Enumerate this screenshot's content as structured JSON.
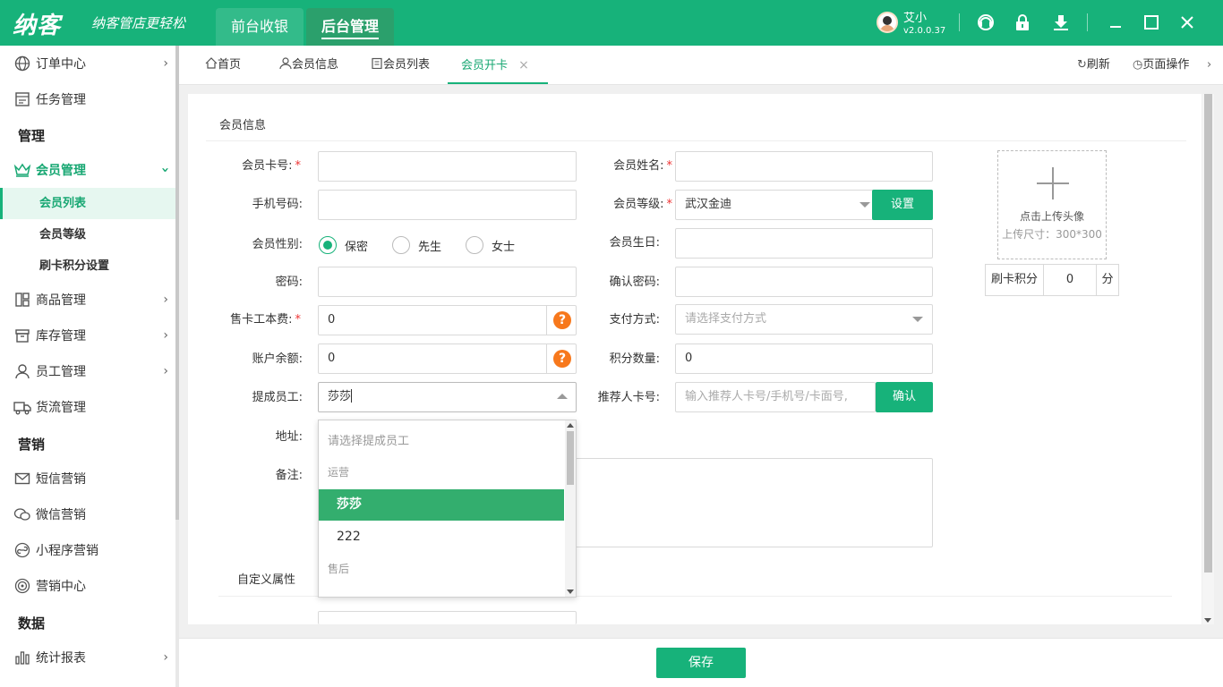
{
  "brand": {
    "logo": "纳客",
    "slogan": "纳客管店更轻松"
  },
  "topnav": [
    {
      "label": "前台收银"
    },
    {
      "label": "后台管理"
    }
  ],
  "user": {
    "name": "艾小",
    "version": "v2.0.0.37"
  },
  "sidebar": {
    "items": [
      {
        "label": "订单中心",
        "icon": "globe-icon"
      },
      {
        "label": "任务管理",
        "icon": "task-icon"
      },
      {
        "label": "会员管理",
        "icon": "crown-icon"
      },
      {
        "label": "商品管理",
        "icon": "goods-icon"
      },
      {
        "label": "库存管理",
        "icon": "box-icon"
      },
      {
        "label": "员工管理",
        "icon": "user-icon"
      },
      {
        "label": "货流管理",
        "icon": "truck-icon"
      },
      {
        "label": "短信营销",
        "icon": "mail-icon"
      },
      {
        "label": "微信营销",
        "icon": "wechat-icon"
      },
      {
        "label": "小程序营销",
        "icon": "miniapp-icon"
      },
      {
        "label": "营销中心",
        "icon": "target-icon"
      },
      {
        "label": "统计报表",
        "icon": "chart-icon"
      }
    ],
    "headers": [
      "管理",
      "营销",
      "数据"
    ],
    "subitems": [
      "会员列表",
      "会员等级",
      "刷卡积分设置"
    ]
  },
  "tabs": [
    {
      "label": "首页"
    },
    {
      "label": "会员信息"
    },
    {
      "label": "会员列表"
    },
    {
      "label": "会员开卡"
    }
  ],
  "tab_actions": {
    "refresh": "刷新",
    "page_ops": "页面操作"
  },
  "form": {
    "section_title": "会员信息",
    "card_no": {
      "label": "会员卡号:",
      "value": ""
    },
    "name": {
      "label": "会员姓名:",
      "value": ""
    },
    "phone": {
      "label": "手机号码:",
      "value": ""
    },
    "level": {
      "label": "会员等级:",
      "value": "武汉金迪",
      "button": "设置"
    },
    "gender": {
      "label": "会员性别:",
      "options": [
        "保密",
        "先生",
        "女士"
      ],
      "selected": "保密"
    },
    "birthday": {
      "label": "会员生日:",
      "value": ""
    },
    "password": {
      "label": "密码:",
      "value": ""
    },
    "confirm_password": {
      "label": "确认密码:",
      "value": ""
    },
    "card_fee": {
      "label": "售卡工本费:",
      "value": "0"
    },
    "payment": {
      "label": "支付方式:",
      "placeholder": "请选择支付方式"
    },
    "balance": {
      "label": "账户余额:",
      "value": "0"
    },
    "points": {
      "label": "积分数量:",
      "value": "0"
    },
    "staff": {
      "label": "提成员工:",
      "value": "莎莎"
    },
    "referrer": {
      "label": "推荐人卡号:",
      "placeholder": "输入推荐人卡号/手机号/卡面号,",
      "button": "确认"
    },
    "address": {
      "label": "地址:"
    },
    "remark": {
      "label": "备注:"
    },
    "custom_title": "自定义属性",
    "required_mark": "*"
  },
  "upload": {
    "line1": "点击上传头像",
    "line2": "上传尺寸：300*300"
  },
  "swipe_points": {
    "label": "刷卡积分",
    "value": "0",
    "unit": "分"
  },
  "dropdown": {
    "placeholder": "请选择提成员工",
    "groups": [
      {
        "name": "运营",
        "options": [
          "莎莎",
          "222"
        ]
      },
      {
        "name": "售后",
        "options": []
      }
    ],
    "selected": "莎莎"
  },
  "save_button": "保存",
  "colors": {
    "primary": "#17b27a",
    "selected_option": "#33ae6e",
    "help_icon": "#f7781c",
    "required": "#e33333"
  }
}
